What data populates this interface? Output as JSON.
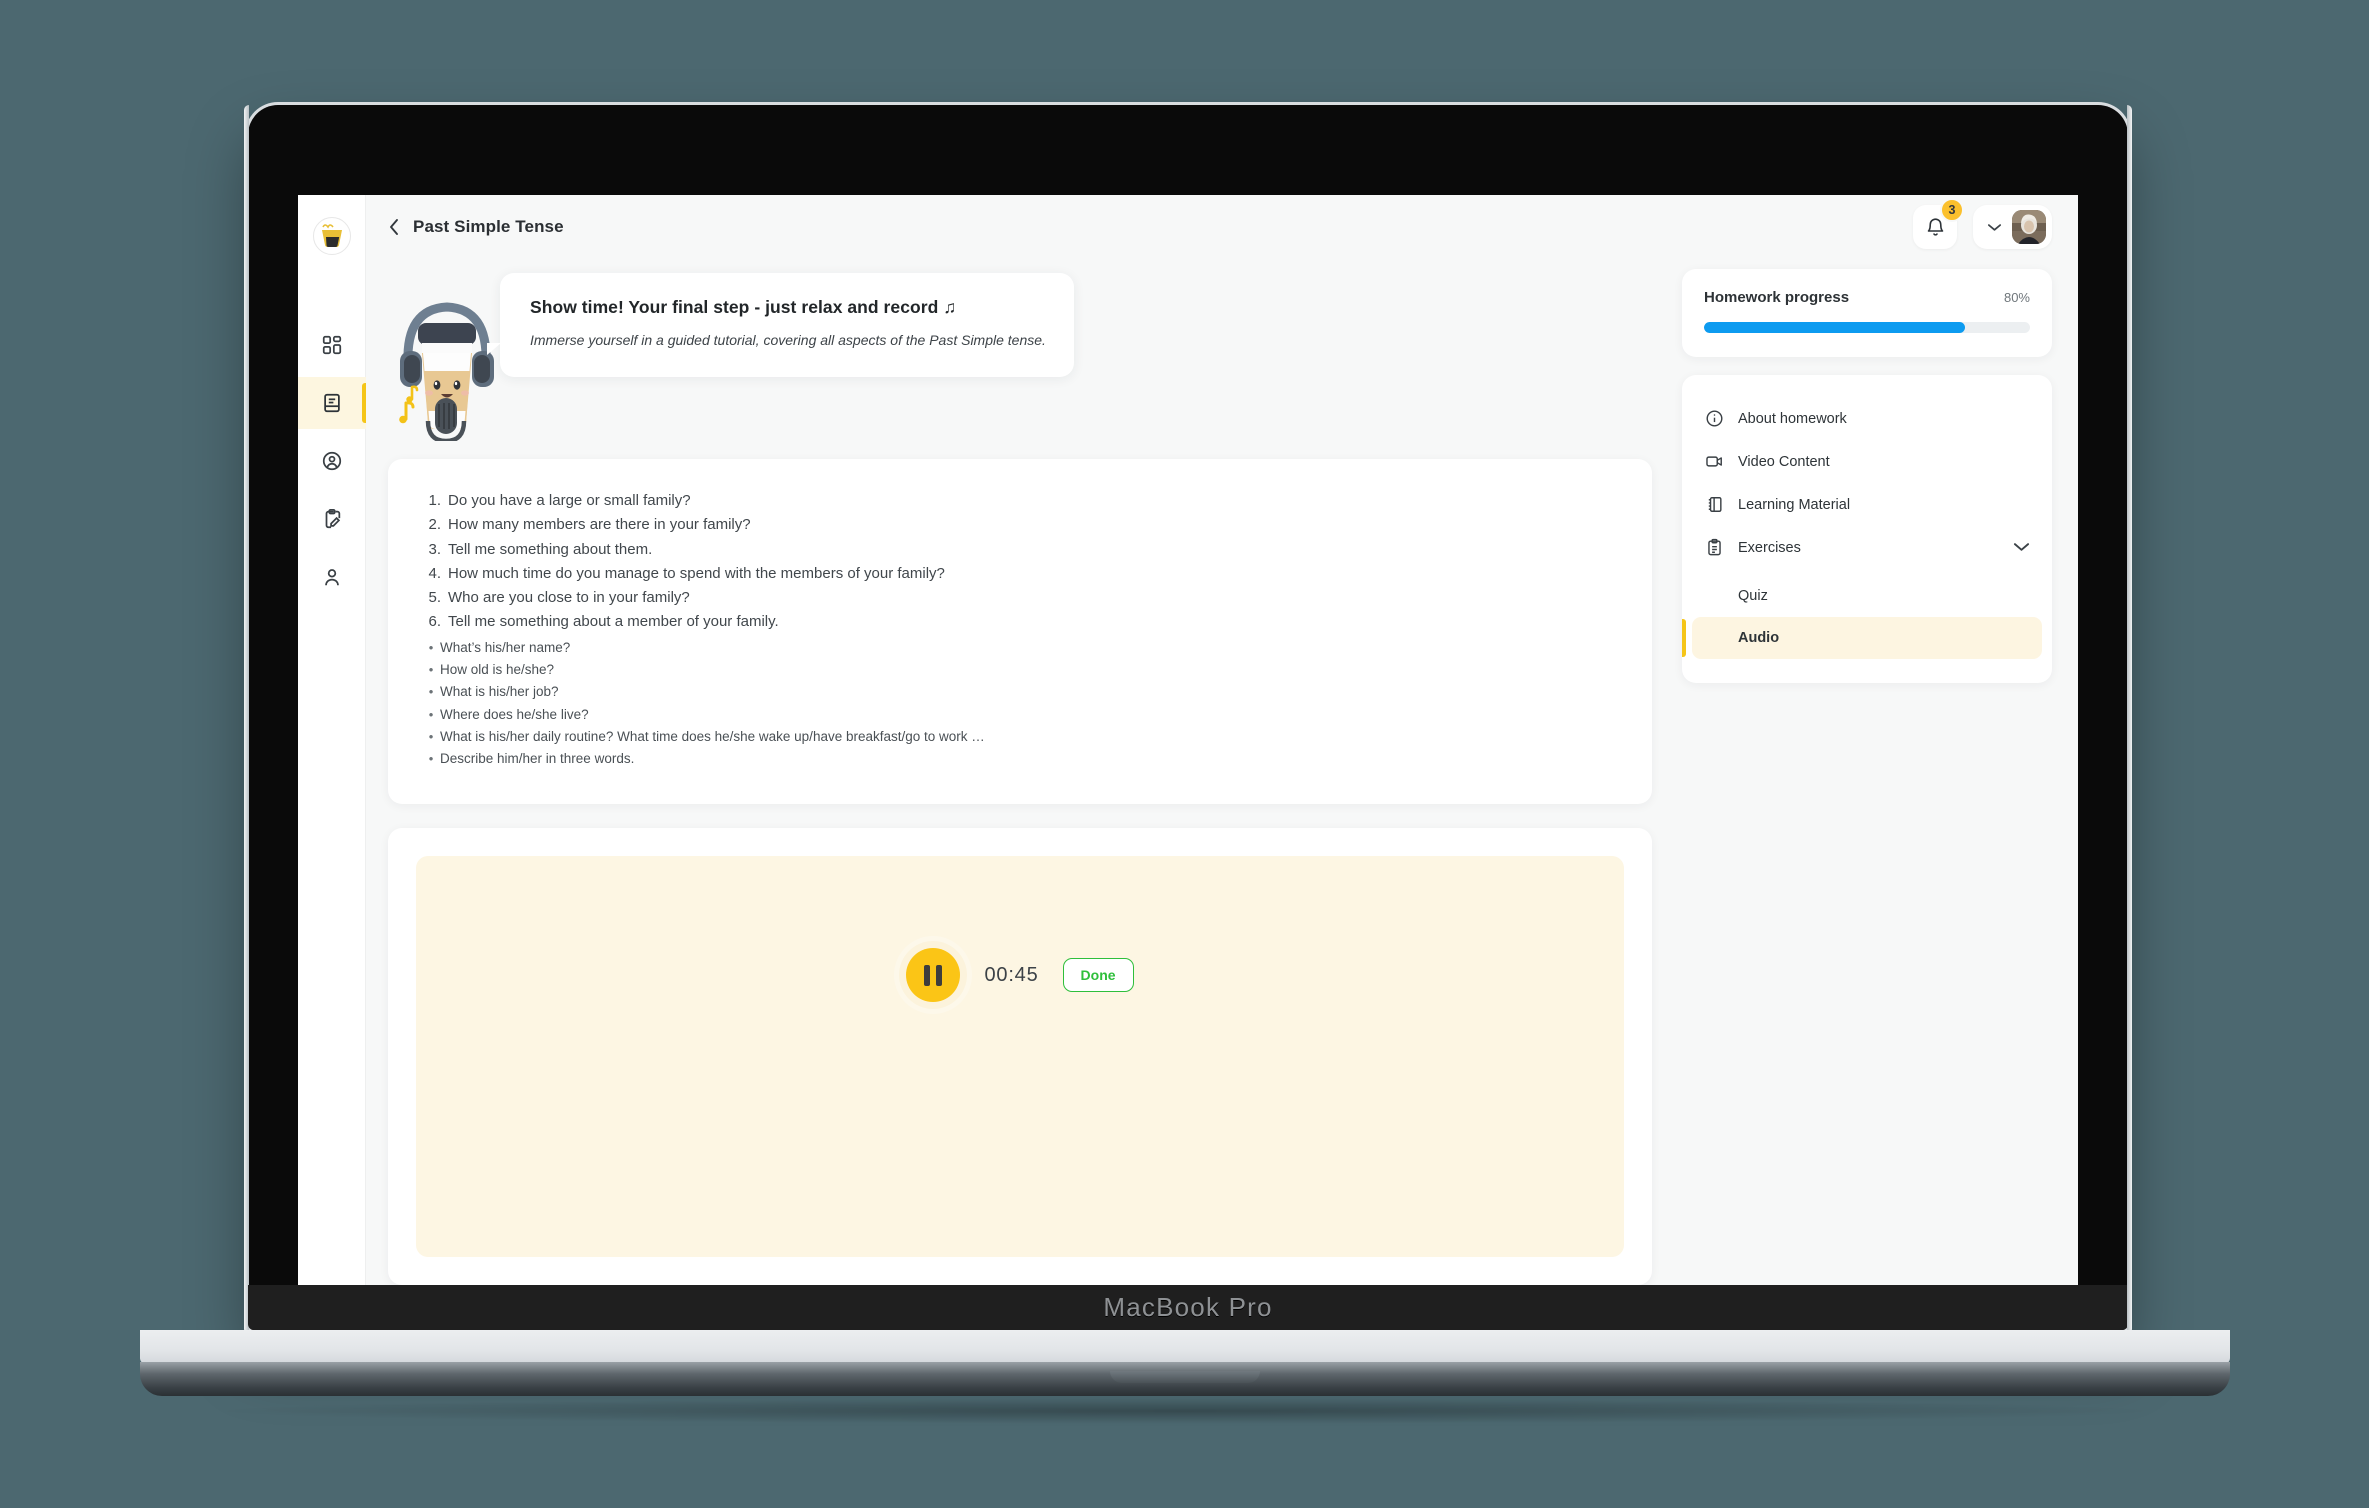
{
  "device": {
    "label": "MacBook Pro"
  },
  "brand": {
    "logo_icon": "coffee-cup-logo"
  },
  "sidebar": {
    "items": [
      {
        "icon": "dashboard-grid-icon",
        "name": "dashboard",
        "active": false
      },
      {
        "icon": "book-icon",
        "name": "lessons",
        "active": true
      },
      {
        "icon": "user-circle-icon",
        "name": "account",
        "active": false
      },
      {
        "icon": "clipboard-edit-icon",
        "name": "homework",
        "active": false
      },
      {
        "icon": "person-icon",
        "name": "profile",
        "active": false
      }
    ]
  },
  "topbar": {
    "back_icon": "chevron-left-icon",
    "title": "Past Simple Tense",
    "bell_icon": "bell-icon",
    "notification_count": "3",
    "chevron_icon": "chevron-down-icon",
    "avatar_alt": "user-avatar"
  },
  "hero": {
    "mascot_icon": "coffee-cup-with-headphones-and-mic",
    "title": "Show time! Your final step - just relax and record ♫",
    "subtitle": "Immerse yourself in a guided tutorial, covering all aspects of the Past Simple tense."
  },
  "questions": {
    "numbered": [
      {
        "num": "1.",
        "text": "Do you have a large or small family?"
      },
      {
        "num": "2.",
        "text": "How many members are there in your family?"
      },
      {
        "num": "3.",
        "text": "Tell me something about them."
      },
      {
        "num": "4.",
        "text": "How much time do you manage to spend with the members of your family?"
      },
      {
        "num": "5.",
        "text": "Who are you close to in your family?"
      },
      {
        "num": "6.",
        "text": "Tell me something about a member of your family."
      }
    ],
    "bullets": [
      "What’s his/her name?",
      "How old is he/she?",
      "What is his/her job?",
      "Where does he/she live?",
      "What is his/her daily routine? What time does he/she wake up/have breakfast/go to work …",
      "Describe him/her in three words."
    ]
  },
  "recorder": {
    "state_icon": "pause-icon",
    "time": "00:45",
    "done_label": "Done",
    "accent_color": "#fbc516",
    "done_color": "#2fbf3b",
    "panel_color": "#fdf6e3"
  },
  "progress": {
    "title": "Homework progress",
    "percent_label": "80%",
    "percent_value": 80,
    "bar_color": "#0d9bf0"
  },
  "menu": {
    "items": [
      {
        "icon": "info-circle-icon",
        "label": "About homework",
        "has_chevron": false
      },
      {
        "icon": "video-camera-icon",
        "label": "Video Content",
        "has_chevron": false
      },
      {
        "icon": "book-open-icon",
        "label": "Learning Material",
        "has_chevron": false
      },
      {
        "icon": "clipboard-list-icon",
        "label": "Exercises",
        "has_chevron": true
      }
    ],
    "submenu": [
      {
        "label": "Quiz",
        "active": false
      },
      {
        "label": "Audio",
        "active": true
      }
    ]
  }
}
